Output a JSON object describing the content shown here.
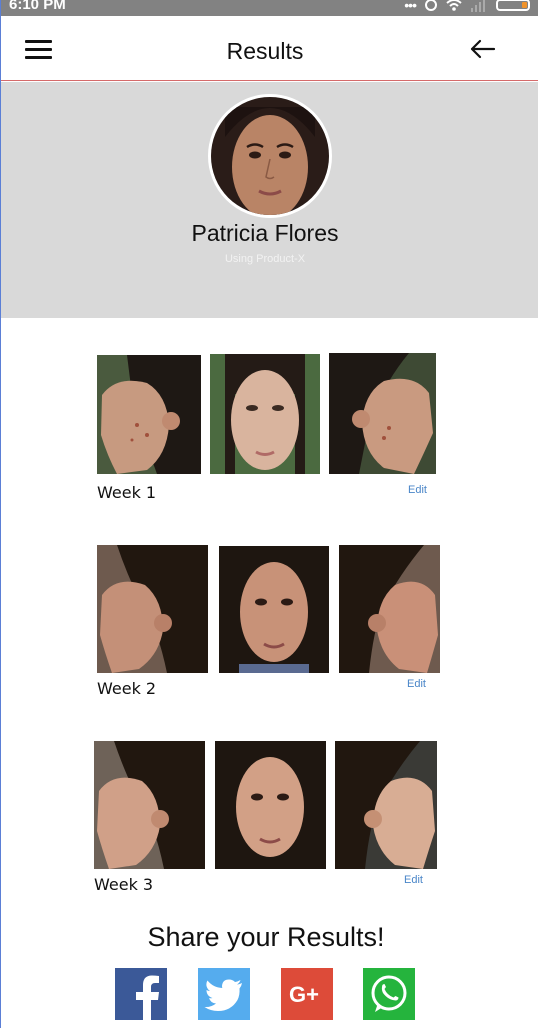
{
  "status_bar": {
    "time": "6:10 PM"
  },
  "header": {
    "title": "Results"
  },
  "profile": {
    "name": "Patricia Flores",
    "subtitle": "Using Product-X"
  },
  "weeks": [
    {
      "label": "Week 1",
      "edit": "Edit"
    },
    {
      "label": "Week 2",
      "edit": "Edit"
    },
    {
      "label": "Week 3",
      "edit": "Edit"
    }
  ],
  "share": {
    "title": "Share your Results!",
    "networks": [
      "facebook-icon",
      "twitter-icon",
      "google-plus-icon",
      "whatsapp-icon"
    ],
    "colors": {
      "facebook": "#3b5998",
      "twitter": "#55acee",
      "google_plus": "#dd4b39",
      "whatsapp": "#25b43d"
    }
  },
  "colors": {
    "accent_line": "#d56b6b",
    "header_bg": "#d9d9d9",
    "link": "#4a86c8"
  }
}
